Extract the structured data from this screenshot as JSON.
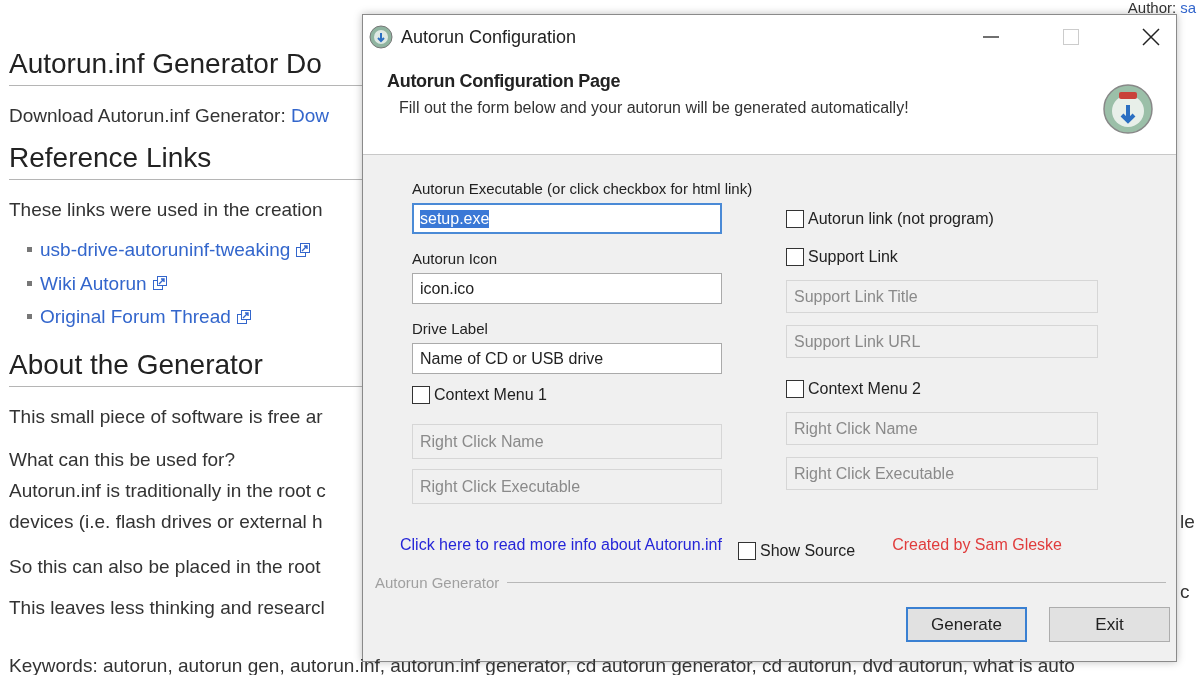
{
  "page": {
    "author": {
      "label": "Author:",
      "link": "sa"
    },
    "blocks": [
      {
        "kind": "heading",
        "text": "Autorun.inf Generator Do"
      },
      {
        "kind": "para",
        "text": "Download Autorun.inf Generator:",
        "link": "Dow"
      },
      {
        "kind": "heading",
        "text": "Reference Links"
      },
      {
        "kind": "para",
        "text": "These links were used in the creation"
      },
      {
        "kind": "list",
        "items": [
          "usb-drive-autoruninf-tweaking",
          "Wiki Autorun",
          "Original Forum Thread"
        ]
      },
      {
        "kind": "heading",
        "text": "About the Generator"
      },
      {
        "kind": "para",
        "text": "This small piece of software is free ar"
      },
      {
        "kind": "lines",
        "lines": [
          "What can this be used for?",
          "Autorun.inf is traditionally in the root c",
          "devices (i.e. flash drives or external h"
        ]
      },
      {
        "kind": "para",
        "text": "So this can also be placed in the root"
      },
      {
        "kind": "para",
        "text": "This leaves less thinking and researcl"
      }
    ],
    "right_fragments": [
      "le",
      "c"
    ],
    "keywords": "Keywords: autorun, autorun gen, autorun.inf, autorun.inf generator, cd autorun generator, cd autorun, dvd autorun, what is auto"
  },
  "dialog": {
    "title": "Autorun Configuration",
    "header": {
      "title": "Autorun Configuration Page",
      "subtitle": "Fill out the form below and your autorun will be generated automatically!"
    },
    "left": [
      {
        "kind": "label",
        "text": "Autorun Executable (or click checkbox for html link)"
      },
      {
        "kind": "field",
        "value": "setup.exe",
        "focused": true,
        "disabled": false
      },
      {
        "kind": "label",
        "text": "Autorun Icon"
      },
      {
        "kind": "field",
        "value": "icon.ico",
        "focused": false,
        "disabled": false
      },
      {
        "kind": "label",
        "text": "Drive Label"
      },
      {
        "kind": "field",
        "value": "Name of CD or USB drive",
        "focused": false,
        "disabled": false
      },
      {
        "kind": "check",
        "label": "Context Menu 1",
        "checked": false
      },
      {
        "kind": "field",
        "placeholder": "Right Click Name",
        "focused": false,
        "disabled": true
      },
      {
        "kind": "field",
        "placeholder": "Right Click Executable",
        "focused": false,
        "disabled": true
      }
    ],
    "right": [
      {
        "kind": "check",
        "label": "Autorun link (not program)",
        "checked": false
      },
      {
        "kind": "check",
        "label": "Support Link",
        "checked": false
      },
      {
        "kind": "field",
        "placeholder": "Support Link Title",
        "focused": false,
        "disabled": true
      },
      {
        "kind": "field",
        "placeholder": "Support Link URL",
        "focused": false,
        "disabled": true
      },
      {
        "kind": "check",
        "label": "Context Menu 2",
        "checked": false
      },
      {
        "kind": "field",
        "placeholder": "Right Click Name",
        "focused": false,
        "disabled": true
      },
      {
        "kind": "field",
        "placeholder": "Right Click Executable",
        "focused": false,
        "disabled": true
      }
    ],
    "info_link": "Click here to read more info about Autorun.inf",
    "show_source": {
      "label": "Show Source",
      "checked": false
    },
    "credit": "Created by Sam Gleske",
    "group_label": "Autorun Generator",
    "buttons": [
      {
        "label": "Generate",
        "default": true
      },
      {
        "label": "Exit",
        "default": false
      }
    ]
  }
}
